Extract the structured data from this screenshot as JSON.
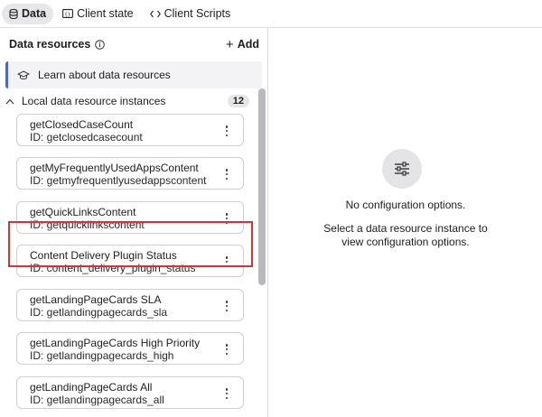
{
  "tabs": [
    {
      "label": "Data",
      "icon": "database-icon",
      "active": true
    },
    {
      "label": "Client state",
      "icon": "client-state-icon",
      "active": false
    },
    {
      "label": "Client Scripts",
      "icon": "code-icon",
      "active": false
    }
  ],
  "left_panel": {
    "title": "Data resources",
    "add_label": "Add",
    "learn_label": "Learn about data resources",
    "section_label": "Local data resource instances",
    "section_count": "12",
    "items": [
      {
        "name": "getClosedCaseCount",
        "id": "ID: getclosedcasecount"
      },
      {
        "name": "getMyFrequentlyUsedAppsContent",
        "id": "ID: getmyfrequentlyusedappscontent"
      },
      {
        "name": "getQuickLinksContent",
        "id": "ID: getquicklinkscontent",
        "highlighted": true
      },
      {
        "name": "Content Delivery Plugin Status",
        "id": "ID: content_delivery_plugin_status"
      },
      {
        "name": "getLandingPageCards SLA",
        "id": "ID: getlandingpagecards_sla"
      },
      {
        "name": "getLandingPageCards High Priority",
        "id": "ID: getlandingpagecards_high"
      },
      {
        "name": "getLandingPageCards All",
        "id": "ID: getlandingpagecards_all"
      }
    ]
  },
  "right_panel": {
    "no_config": "No configuration options.",
    "select_message": "Select a data resource instance to view configuration options."
  },
  "colors": {
    "accent_bar": "#4b64d4",
    "highlight_border": "#d9342b"
  }
}
